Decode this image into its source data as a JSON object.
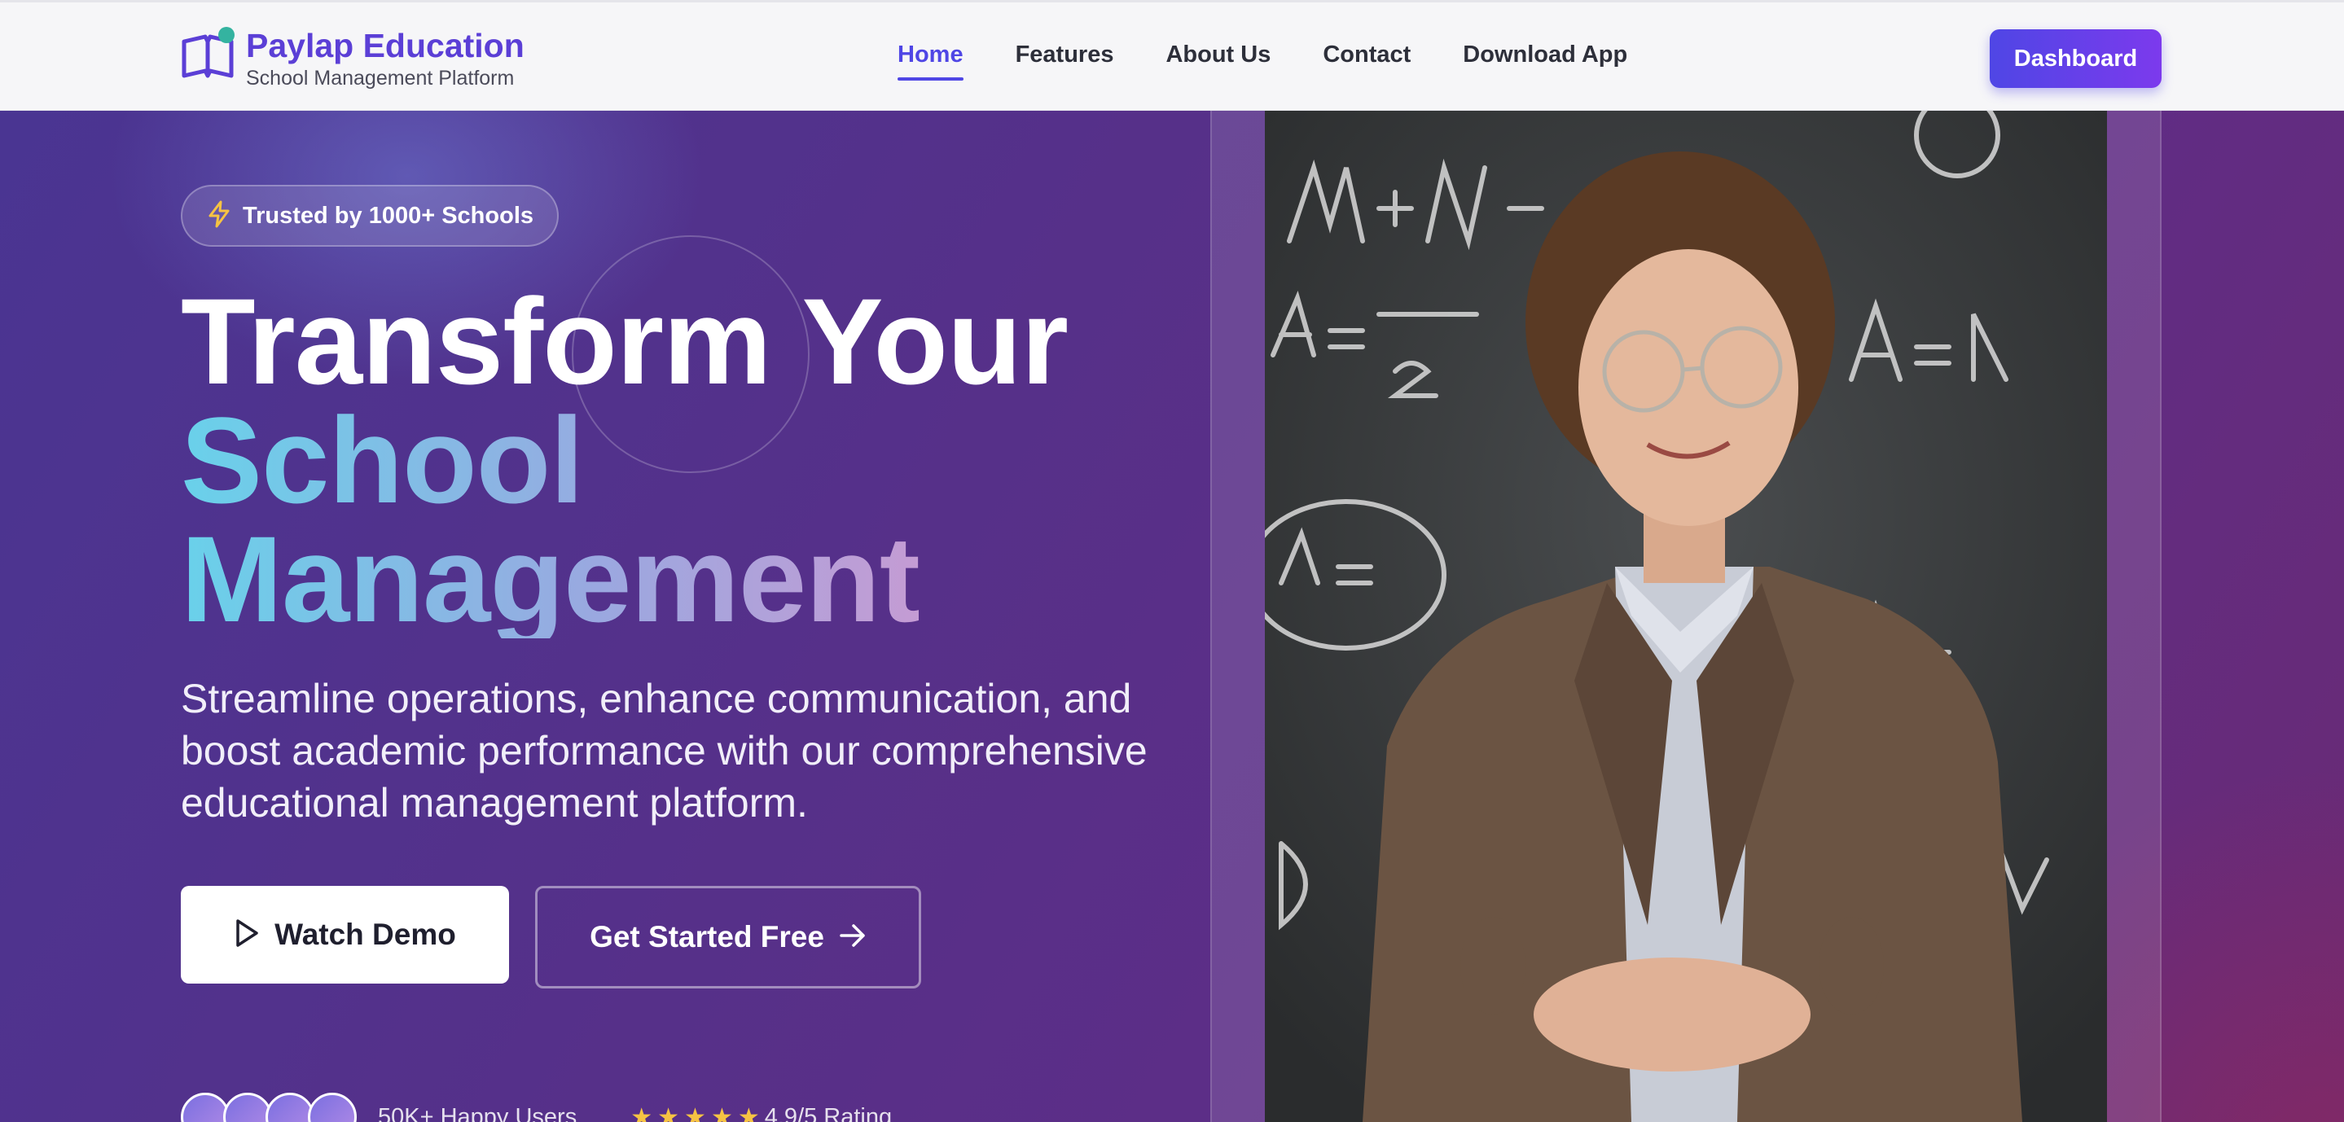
{
  "header": {
    "brand": {
      "name": "Paylap Education",
      "tagline": "School Management Platform"
    },
    "nav": [
      {
        "label": "Home",
        "active": true
      },
      {
        "label": "Features",
        "active": false
      },
      {
        "label": "About Us",
        "active": false
      },
      {
        "label": "Contact",
        "active": false
      },
      {
        "label": "Download App",
        "active": false
      }
    ],
    "dashboard_label": "Dashboard"
  },
  "hero": {
    "badge": {
      "icon": "lightning-icon",
      "text": "Trusted by 1000+ Schools"
    },
    "title": {
      "line1": "Transform Your",
      "line2": "School",
      "line3": "Management"
    },
    "subtitle": "Streamline operations, enhance communication, and boost academic performance with our comprehensive educational management platform.",
    "buttons": {
      "demo": {
        "icon": "play-icon",
        "label": "Watch Demo"
      },
      "start": {
        "icon": "arrow-right-icon",
        "label": "Get Started Free"
      }
    },
    "social_proof": {
      "users": "50K+ Happy Users",
      "stars": 5,
      "rating": "4.9/5 Rating"
    },
    "image": {
      "subject": "teacher-photo"
    }
  },
  "colors": {
    "brand": "#5b3fd6",
    "accent": "#4f46e5",
    "hero_bg": "#563089",
    "gradient_start": "#69d1ea",
    "gradient_end": "#c79bd3",
    "star": "#f6c343"
  }
}
